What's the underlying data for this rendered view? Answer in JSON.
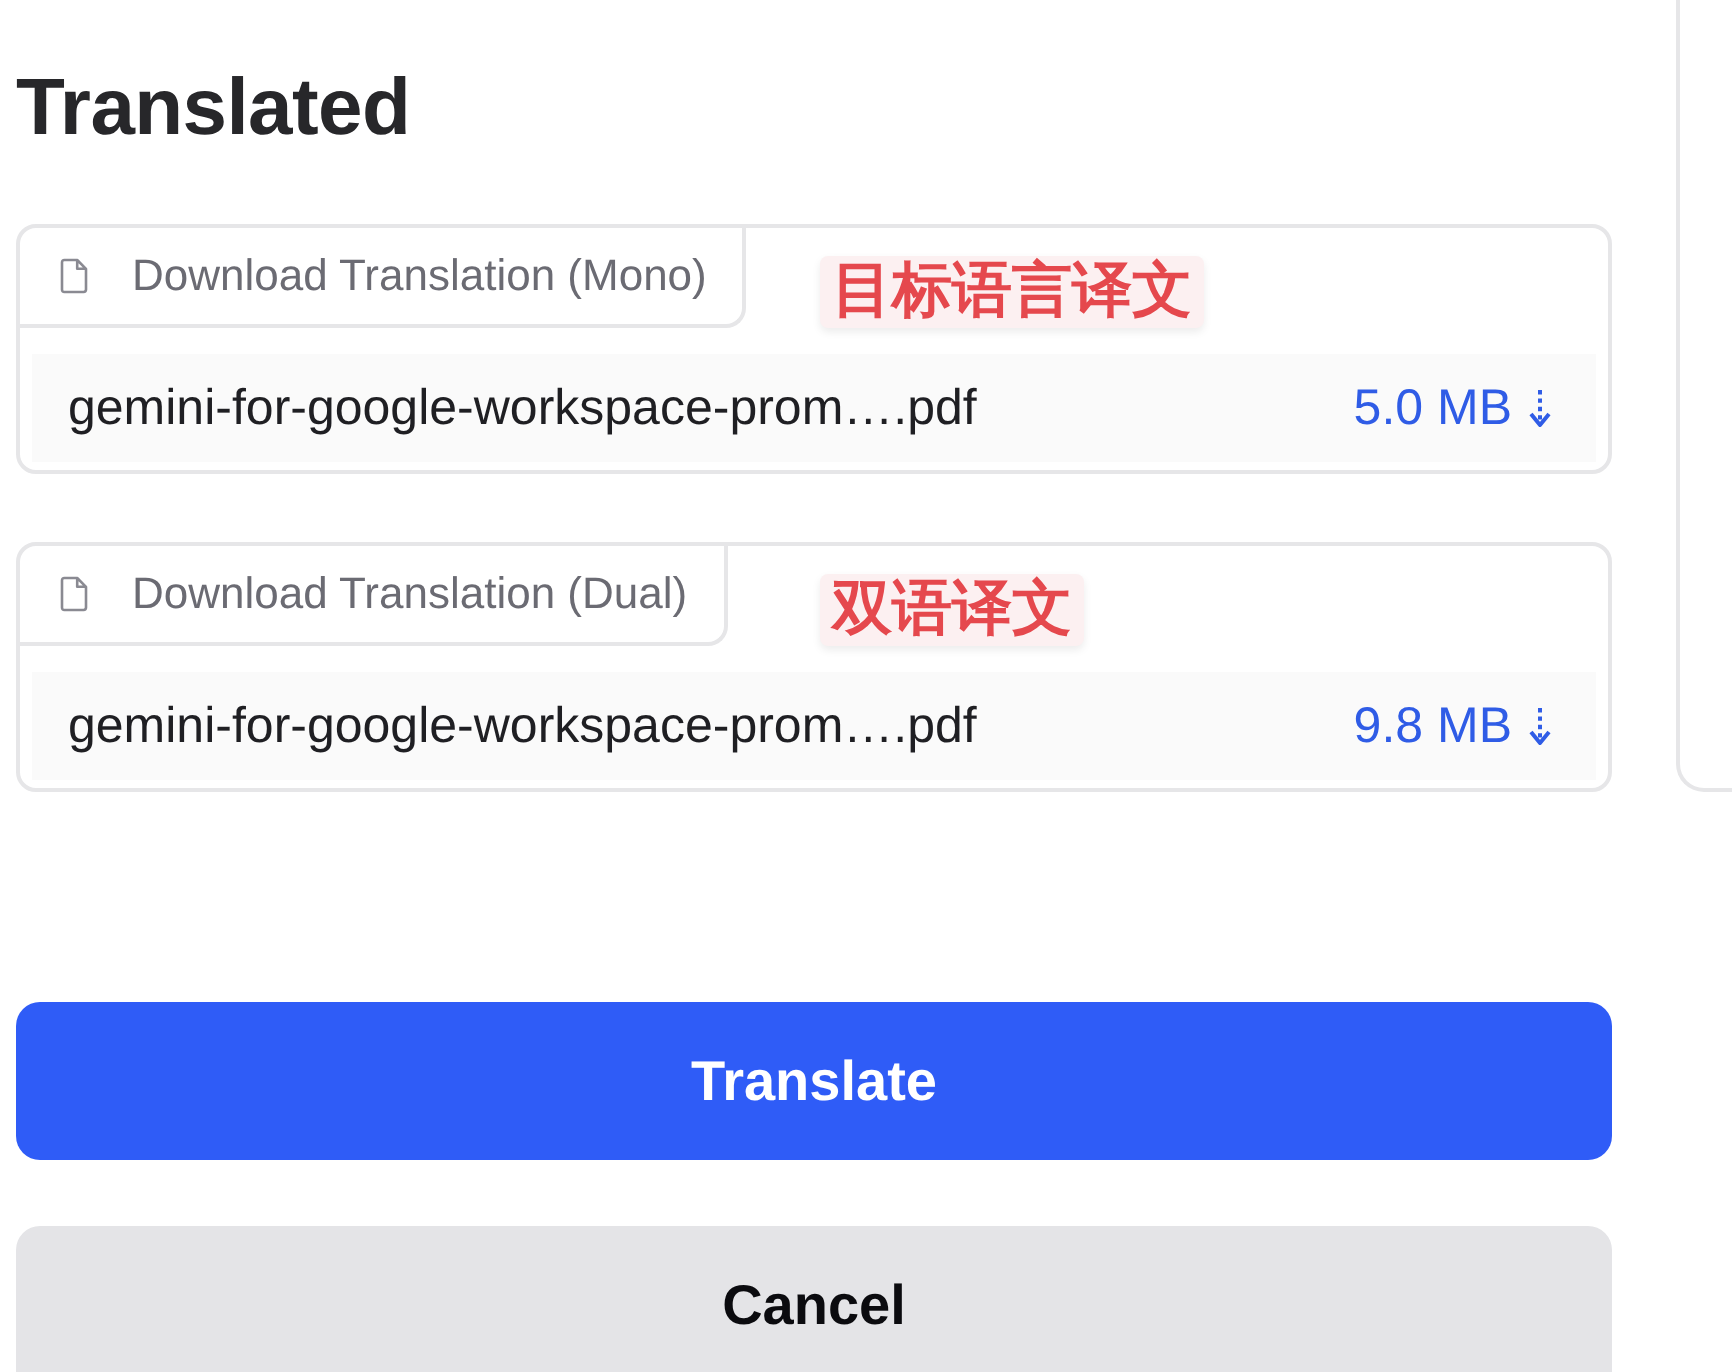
{
  "heading": "Translated",
  "downloads": [
    {
      "label": "Download Translation (Mono)",
      "annotation": "目标语言译文",
      "file_name": "gemini-for-google-workspace-prom….pdf",
      "file_size": "5.0 MB"
    },
    {
      "label": "Download Translation (Dual)",
      "annotation": "双语译文",
      "file_name": "gemini-for-google-workspace-prom….pdf",
      "file_size": "9.8 MB"
    }
  ],
  "buttons": [
    {
      "label": "Translate",
      "kind": "primary"
    },
    {
      "label": "Cancel",
      "kind": "secondary"
    }
  ]
}
